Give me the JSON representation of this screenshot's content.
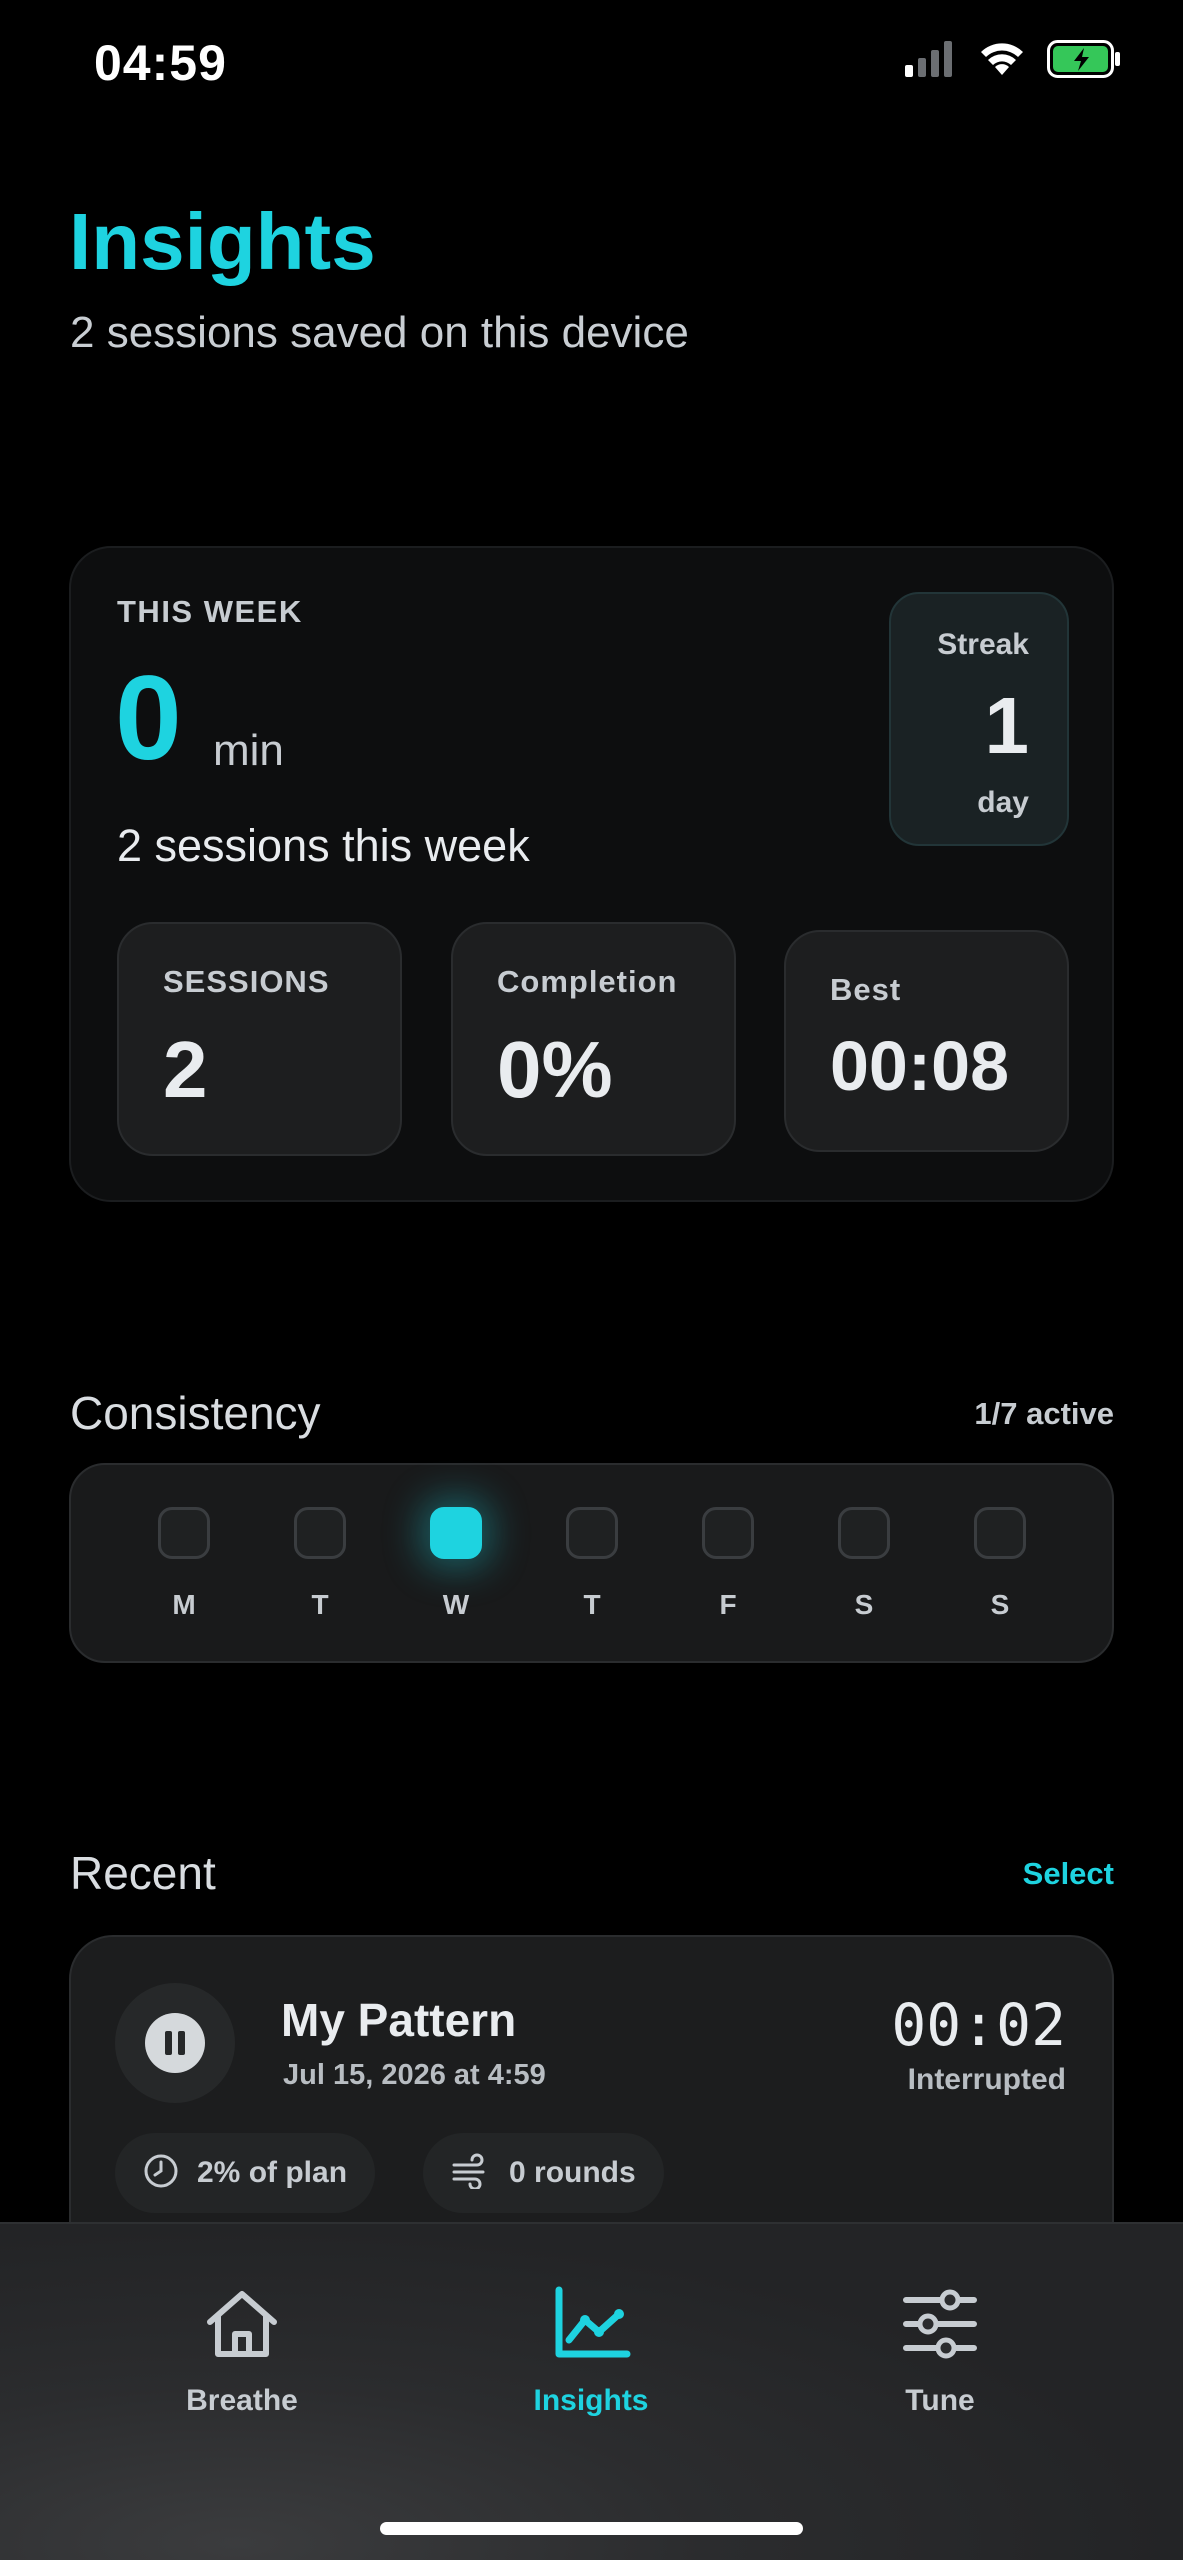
{
  "status_bar": {
    "time": "04:59"
  },
  "header": {
    "title": "Insights",
    "subtitle": "2 sessions saved on this device"
  },
  "week_card": {
    "eyebrow": "THIS WEEK",
    "minutes_value": "0",
    "minutes_unit": "min",
    "sessions_text": "2 sessions this week",
    "streak": {
      "label": "Streak",
      "value": "1",
      "unit": "day"
    },
    "stats": [
      {
        "label": "SESSIONS",
        "value": "2"
      },
      {
        "label": "Completion",
        "value": "0%"
      },
      {
        "label": "Best",
        "value": "00:08"
      }
    ]
  },
  "consistency": {
    "title": "Consistency",
    "meta": "1/7 active",
    "days": [
      {
        "label": "M",
        "active": false
      },
      {
        "label": "T",
        "active": false
      },
      {
        "label": "W",
        "active": true
      },
      {
        "label": "T",
        "active": false
      },
      {
        "label": "F",
        "active": false
      },
      {
        "label": "S",
        "active": false
      },
      {
        "label": "S",
        "active": false
      }
    ]
  },
  "recent": {
    "title": "Recent",
    "select_label": "Select",
    "items": [
      {
        "title": "My Pattern",
        "date": "Jul 15, 2026 at 4:59",
        "duration": "00:02",
        "status": "Interrupted",
        "chips": [
          {
            "icon": "clock-icon",
            "text": "2% of plan"
          },
          {
            "icon": "wind-icon",
            "text": "0 rounds"
          }
        ]
      }
    ]
  },
  "tab_bar": {
    "tabs": [
      {
        "label": "Breathe",
        "icon": "home-icon",
        "active": false
      },
      {
        "label": "Insights",
        "icon": "chart-icon",
        "active": true
      },
      {
        "label": "Tune",
        "icon": "sliders-icon",
        "active": false
      }
    ]
  },
  "colors": {
    "accent": "#1ed3e0",
    "background": "#000000",
    "card": "#1c1d1e"
  }
}
